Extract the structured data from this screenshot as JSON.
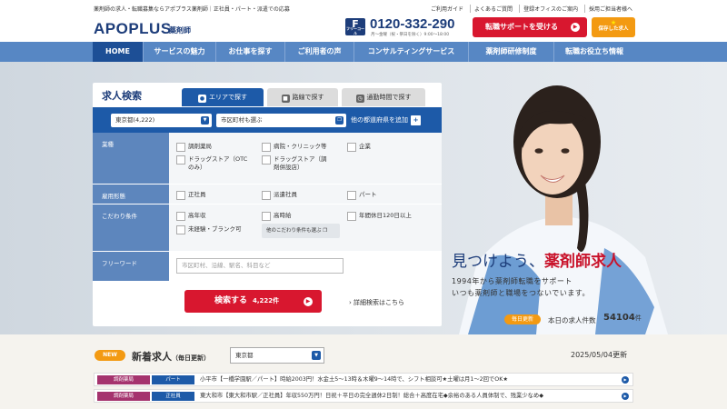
{
  "header": {
    "tagline": "薬剤師の求人・転職募集ならアポプラス薬剤師｜正社員・パート・派遣での応募",
    "logo_text": "APOPLUS",
    "logo_sub": "薬剤師",
    "tel_icon_label": "F",
    "tel_icon_sub": "フリーコール",
    "tel_number": "0120-332-290",
    "tel_hours": "月〜金曜（祝・祭日を除く）9:00〜18:00",
    "util_links": [
      "ご利用ガイド",
      "よくあるご質問",
      "登録オフィスのご案内",
      "採用ご担当者様へ"
    ],
    "cta_label": "転職サポートを受ける",
    "save_label": "保存した求人"
  },
  "nav": {
    "items": [
      "HOME",
      "サービスの魅力",
      "お仕事を探す",
      "ご利用者の声",
      "コンサルティングサービス",
      "薬剤師研修制度",
      "転職お役立ち情報"
    ]
  },
  "hero": {
    "title_prefix": "見つけよう、",
    "title_emph": "薬剤師求人",
    "line1": "1994年から薬剤師転職をサポート",
    "line2": "いつも薬剤師と職場をつないでいます。",
    "badge": "毎日更新",
    "count_label": "本日の求人件数",
    "count_value": "54104",
    "count_unit": "件"
  },
  "search": {
    "title": "求人検索",
    "tabs": [
      "エリアで探す",
      "路線で探す",
      "通勤時間で探す"
    ],
    "prefecture": "東京都(4,222)",
    "city": "市区町村も選ぶ",
    "add_pref": "他の都道府県を追加",
    "sections": {
      "industry": "業種",
      "employment": "雇用形態",
      "preferences": "こだわり条件",
      "free_word": "フリーワード"
    },
    "industry_options": [
      "調剤薬局",
      "病院・クリニック等",
      "企業",
      "ドラッグストア（OTCのみ）",
      "ドラッグストア（調剤併設店）"
    ],
    "employment_options": [
      "正社員",
      "派遣社員",
      "パート"
    ],
    "preference_options": [
      "高年収",
      "高時給",
      "年間休日120日以上",
      "未経験・ブランク可"
    ],
    "more_conditions": "他のこだわり条件も選ぶ",
    "free_word_placeholder": "市区町村、沿線、駅名、科目など",
    "search_button": "検索する",
    "search_count": "4,222件",
    "detail_link": "詳細検索はこちら"
  },
  "news": {
    "badge": "NEW",
    "title": "新着求人",
    "title_sub": "（毎日更新）",
    "prefecture": "東京都",
    "date": "2025/05/04更新",
    "rows": [
      {
        "type": "調剤薬局",
        "employment": "パート",
        "text": "小平市【一橋学園駅／パート】時給2003円！水金土5〜13時＆木曜9〜14時で、シフト相談可★土曜は月1〜2回でOK★"
      },
      {
        "type": "調剤薬局",
        "employment": "正社員",
        "text": "東大和市【東大和市駅／正社員】年収550万円！日祝＋平日の完全週休2日制！総合＋高度在宅◆余裕のある人員体制で、残業少なめ◆"
      }
    ]
  }
}
